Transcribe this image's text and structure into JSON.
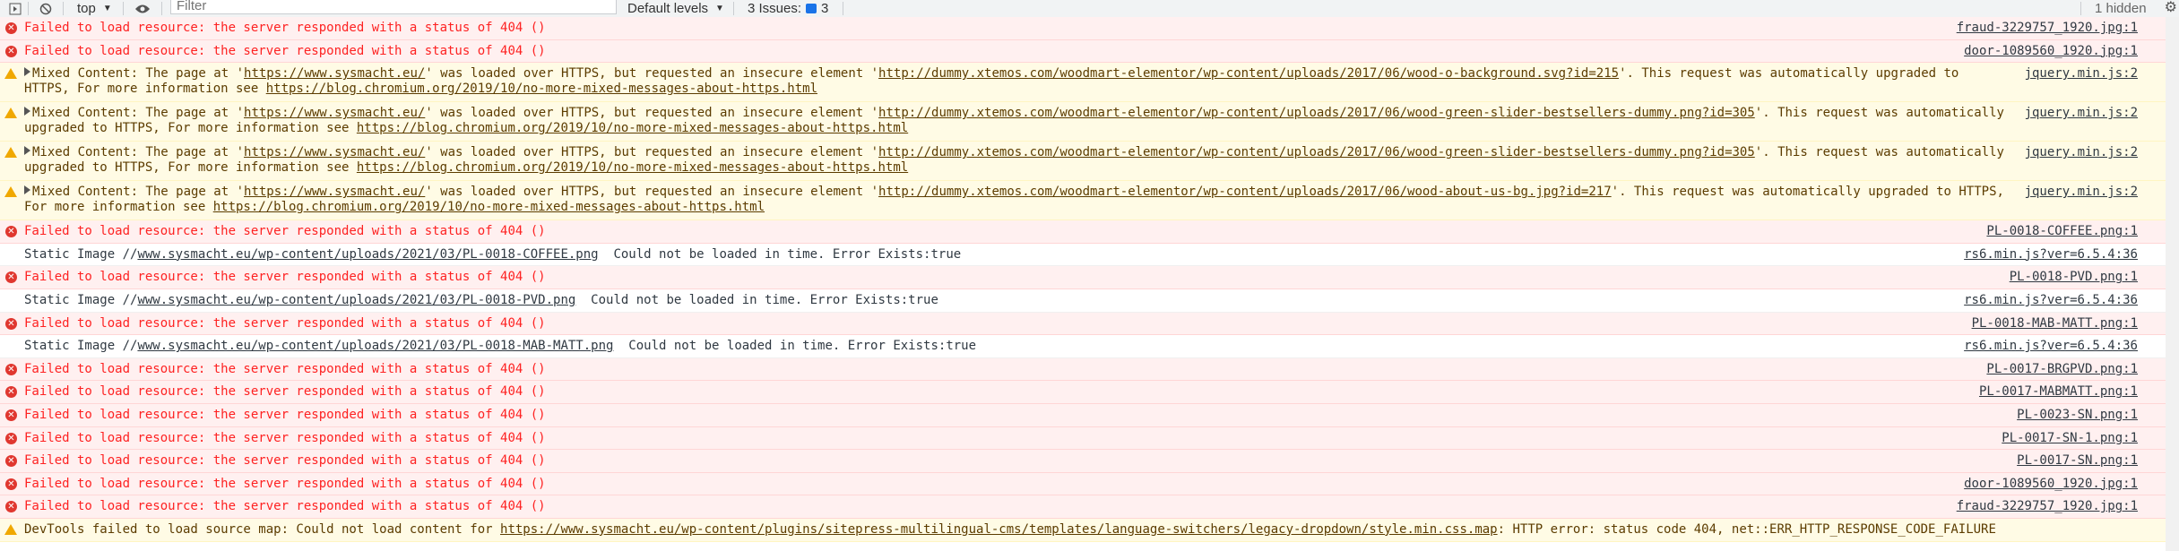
{
  "toolbar": {
    "context": "top",
    "filter_placeholder": "Filter",
    "levels": "Default levels",
    "issues_label": "3 Issues:",
    "issues_count": "3",
    "hidden": "1 hidden"
  },
  "rows": [
    {
      "level": "error",
      "msg": "Failed to load resource: the server responded with a status of 404 ()",
      "src": "fraud-3229757_1920.jpg:1"
    },
    {
      "level": "error",
      "msg": "Failed to load resource: the server responded with a status of 404 ()",
      "src": "door-1089560_1920.jpg:1"
    },
    {
      "level": "warning",
      "pre": "Mixed Content: The page at '",
      "u1": "https://www.sysmacht.eu/",
      "mid": "' was loaded over HTTPS, but requested an insecure element '",
      "u2": "http://dummy.xtemos.com/woodmart-elementor/wp-content/uploads/2017/06/wood-o-background.svg?id=215",
      "post": "'. This request was automatically upgraded to HTTPS, For more information see ",
      "u3": "https://blog.chromium.org/2019/10/no-more-mixed-messages-about-https.html",
      "src": "jquery.min.js:2"
    },
    {
      "level": "warning",
      "pre": "Mixed Content: The page at '",
      "u1": "https://www.sysmacht.eu/",
      "mid": "' was loaded over HTTPS, but requested an insecure element '",
      "u2": "http://dummy.xtemos.com/woodmart-elementor/wp-content/uploads/2017/06/wood-green-slider-bestsellers-dummy.png?id=305",
      "post": "'. This request was automatically upgraded to HTTPS, For more information see ",
      "u3": "https://blog.chromium.org/2019/10/no-more-mixed-messages-about-https.html",
      "src": "jquery.min.js:2"
    },
    {
      "level": "warning",
      "pre": "Mixed Content: The page at '",
      "u1": "https://www.sysmacht.eu/",
      "mid": "' was loaded over HTTPS, but requested an insecure element '",
      "u2": "http://dummy.xtemos.com/woodmart-elementor/wp-content/uploads/2017/06/wood-green-slider-bestsellers-dummy.png?id=305",
      "post": "'. This request was automatically upgraded to HTTPS, For more information see ",
      "u3": "https://blog.chromium.org/2019/10/no-more-mixed-messages-about-https.html",
      "src": "jquery.min.js:2"
    },
    {
      "level": "warning",
      "pre": "Mixed Content: The page at '",
      "u1": "https://www.sysmacht.eu/",
      "mid": "' was loaded over HTTPS, but requested an insecure element '",
      "u2": "http://dummy.xtemos.com/woodmart-elementor/wp-content/uploads/2017/06/wood-about-us-bg.jpg?id=217",
      "post": "'. This request was automatically upgraded to HTTPS, For more information see ",
      "u3": "https://blog.chromium.org/2019/10/no-more-mixed-messages-about-https.html",
      "src": "jquery.min.js:2"
    },
    {
      "level": "error",
      "msg": "Failed to load resource: the server responded with a status of 404 ()",
      "src": "PL-0018-COFFEE.png:1"
    },
    {
      "level": "log",
      "pre": "Static Image //",
      "u1": "www.sysmacht.eu/wp-content/uploads/2021/03/PL-0018-COFFEE.png",
      "post": "  Could not be loaded in time. Error Exists:true",
      "src": "rs6.min.js?ver=6.5.4:36"
    },
    {
      "level": "error",
      "msg": "Failed to load resource: the server responded with a status of 404 ()",
      "src": "PL-0018-PVD.png:1"
    },
    {
      "level": "log",
      "pre": "Static Image //",
      "u1": "www.sysmacht.eu/wp-content/uploads/2021/03/PL-0018-PVD.png",
      "post": "  Could not be loaded in time. Error Exists:true",
      "src": "rs6.min.js?ver=6.5.4:36"
    },
    {
      "level": "error",
      "msg": "Failed to load resource: the server responded with a status of 404 ()",
      "src": "PL-0018-MAB-MATT.png:1"
    },
    {
      "level": "log",
      "pre": "Static Image //",
      "u1": "www.sysmacht.eu/wp-content/uploads/2021/03/PL-0018-MAB-MATT.png",
      "post": "  Could not be loaded in time. Error Exists:true",
      "src": "rs6.min.js?ver=6.5.4:36"
    },
    {
      "level": "error",
      "msg": "Failed to load resource: the server responded with a status of 404 ()",
      "src": "PL-0017-BRGPVD.png:1"
    },
    {
      "level": "error",
      "msg": "Failed to load resource: the server responded with a status of 404 ()",
      "src": "PL-0017-MABMATT.png:1"
    },
    {
      "level": "error",
      "msg": "Failed to load resource: the server responded with a status of 404 ()",
      "src": "PL-0023-SN.png:1"
    },
    {
      "level": "error",
      "msg": "Failed to load resource: the server responded with a status of 404 ()",
      "src": "PL-0017-SN-1.png:1"
    },
    {
      "level": "error",
      "msg": "Failed to load resource: the server responded with a status of 404 ()",
      "src": "PL-0017-SN.png:1"
    },
    {
      "level": "error",
      "msg": "Failed to load resource: the server responded with a status of 404 ()",
      "src": "door-1089560_1920.jpg:1"
    },
    {
      "level": "error",
      "msg": "Failed to load resource: the server responded with a status of 404 ()",
      "src": "fraud-3229757_1920.jpg:1"
    },
    {
      "level": "devtools",
      "pre": "DevTools failed to load source map: Could not load content for ",
      "u1": "https://www.sysmacht.eu/wp-content/plugins/sitepress-multilingual-cms/templates/language-switchers/legacy-dropdown/style.min.css.map",
      "post": ": HTTP error: status code 404, net::ERR_HTTP_RESPONSE_CODE_FAILURE"
    }
  ]
}
